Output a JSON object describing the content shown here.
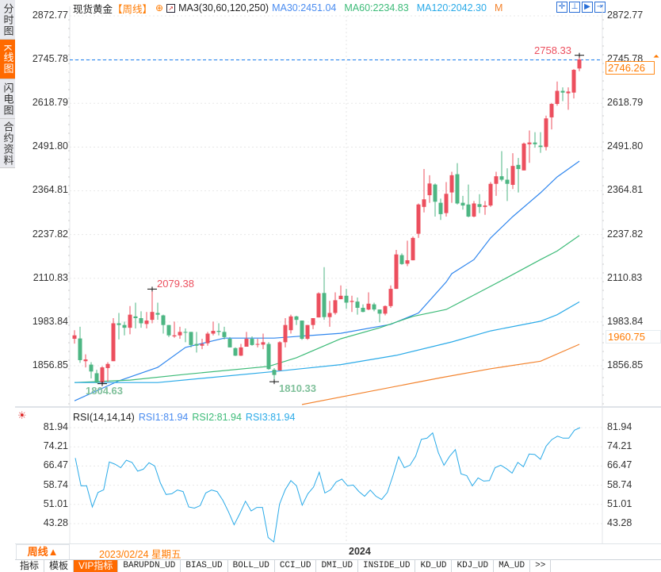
{
  "sidebar": {
    "tabs": [
      {
        "label": "分时图"
      },
      {
        "label": "K线图",
        "active": true
      },
      {
        "label": "闪电图"
      },
      {
        "label": "合约资料"
      }
    ]
  },
  "header": {
    "instrument": "现货黄金",
    "period": "【周线】",
    "ma_label": "MA3(30,60,120,250)",
    "ma30": "MA30:2451.04",
    "ma60": "MA60:2234.83",
    "ma120": "MA120:2042.30",
    "ma_more": "M",
    "toolbar_icons": [
      "crosshair-icon",
      "range-icon",
      "play-icon",
      "exit-icon"
    ]
  },
  "colors": {
    "up": "#ec4f5e",
    "down": "#4db683",
    "ma30": "#2f86ee",
    "ma60": "#3dbb78",
    "ma120": "#2aaae8",
    "ma250": "#f3832d",
    "accent": "#ff6a00",
    "lastline": "#1a7ff0"
  },
  "price_axis": {
    "ticks": [
      "2872.77",
      "2745.78",
      "2618.79",
      "2491.80",
      "2364.81",
      "2237.82",
      "2110.83",
      "1983.84",
      "1856.85"
    ],
    "last_price": "2746.26",
    "ma250_tag": "1960.75"
  },
  "annotations": {
    "high": "2758.33",
    "mid_high": "2079.38",
    "low1": "1804.63",
    "low2": "1810.33"
  },
  "chart_data": [
    {
      "type": "candlestick",
      "period": "weekly",
      "candles_ohlc": [
        [
          1935,
          1960,
          1921,
          1945
        ],
        [
          1936,
          1970,
          1865,
          1873
        ],
        [
          1870,
          1890,
          1852,
          1875
        ],
        [
          1860,
          1867,
          1820,
          1840
        ],
        [
          1835,
          1845,
          1806,
          1808
        ],
        [
          1808,
          1855,
          1804.63,
          1852
        ],
        [
          1850,
          1867,
          1810,
          1862
        ],
        [
          1870,
          1995,
          1870,
          1980
        ],
        [
          1980,
          2010,
          1933,
          1975
        ],
        [
          1975,
          1985,
          1945,
          1967
        ],
        [
          1967,
          2030,
          1948,
          2005
        ],
        [
          2000,
          2040,
          1965,
          1995
        ],
        [
          1995,
          2015,
          1967,
          1980
        ],
        [
          1978,
          2013,
          1965,
          1988
        ],
        [
          1990,
          2079.38,
          1980,
          2013
        ],
        [
          2010,
          2040,
          1990,
          2005
        ],
        [
          2003,
          2005,
          1950,
          1975
        ],
        [
          1975,
          1975,
          1940,
          1945
        ],
        [
          1942,
          1985,
          1938,
          1945
        ],
        [
          1945,
          1970,
          1935,
          1955
        ],
        [
          1955,
          1965,
          1925,
          1953
        ],
        [
          1955,
          1955,
          1910,
          1917
        ],
        [
          1920,
          1955,
          1895,
          1915
        ],
        [
          1915,
          1935,
          1905,
          1920
        ],
        [
          1922,
          1955,
          1915,
          1950
        ],
        [
          1950,
          1985,
          1945,
          1958
        ],
        [
          1958,
          1980,
          1945,
          1955
        ],
        [
          1955,
          1970,
          1933,
          1940
        ],
        [
          1935,
          1940,
          1910,
          1910
        ],
        [
          1908,
          1910,
          1885,
          1886
        ],
        [
          1886,
          1920,
          1885,
          1910
        ],
        [
          1912,
          1955,
          1912,
          1935
        ],
        [
          1935,
          1942,
          1915,
          1917
        ],
        [
          1918,
          1935,
          1910,
          1920
        ],
        [
          1918,
          1950,
          1905,
          1925
        ],
        [
          1920,
          1925,
          1845,
          1847
        ],
        [
          1845,
          1850,
          1810.33,
          1830
        ],
        [
          1843,
          1928,
          1843,
          1925
        ],
        [
          1925,
          1995,
          1910,
          1975
        ],
        [
          1960,
          2005,
          1950,
          2000
        ],
        [
          2000,
          2002,
          1975,
          1990
        ],
        [
          1988,
          1988,
          1932,
          1935
        ],
        [
          1935,
          1975,
          1932,
          1975
        ],
        [
          1975,
          1995,
          1963,
          1995
        ],
        [
          1997,
          2070,
          1997,
          2067
        ],
        [
          2068,
          2143,
          1990,
          1998
        ],
        [
          1998,
          2045,
          1970,
          2010
        ],
        [
          2010,
          2070,
          2005,
          2047
        ],
        [
          2050,
          2090,
          2050,
          2060
        ],
        [
          2060,
          2080,
          2022,
          2040
        ],
        [
          2042,
          2060,
          2013,
          2045
        ],
        [
          2043,
          2055,
          2005,
          2025
        ],
        [
          2025,
          2035,
          2012,
          2013
        ],
        [
          2020,
          2070,
          2018,
          2037
        ],
        [
          2035,
          2040,
          2015,
          2020
        ],
        [
          2020,
          2020,
          1983,
          2008
        ],
        [
          2008,
          2032,
          2003,
          2030
        ],
        [
          2030,
          2090,
          2025,
          2080
        ],
        [
          2080,
          2193,
          2080,
          2180
        ],
        [
          2178,
          2183,
          2150,
          2152
        ],
        [
          2153,
          2220,
          2146,
          2163
        ],
        [
          2163,
          2232,
          2163,
          2228
        ],
        [
          2240,
          2328,
          2228,
          2325
        ],
        [
          2318,
          2428,
          2302,
          2340
        ],
        [
          2352,
          2410,
          2330,
          2386
        ],
        [
          2383,
          2386,
          2290,
          2333
        ],
        [
          2330,
          2342,
          2280,
          2297
        ],
        [
          2300,
          2390,
          2290,
          2356
        ],
        [
          2360,
          2420,
          2330,
          2410
        ],
        [
          2413,
          2445,
          2325,
          2328
        ],
        [
          2330,
          2350,
          2310,
          2322
        ],
        [
          2325,
          2383,
          2288,
          2290
        ],
        [
          2290,
          2335,
          2288,
          2328
        ],
        [
          2326,
          2355,
          2300,
          2318
        ],
        [
          2318,
          2335,
          2295,
          2322
        ],
        [
          2322,
          2390,
          2318,
          2385
        ],
        [
          2385,
          2420,
          2350,
          2407
        ],
        [
          2407,
          2480,
          2392,
          2397
        ],
        [
          2397,
          2430,
          2335,
          2385
        ],
        [
          2382,
          2474,
          2370,
          2437
        ],
        [
          2440,
          2460,
          2360,
          2428
        ],
        [
          2424,
          2505,
          2424,
          2502
        ],
        [
          2500,
          2540,
          2446,
          2505
        ],
        [
          2505,
          2535,
          2490,
          2500
        ],
        [
          2496,
          2535,
          2475,
          2492
        ],
        [
          2492,
          2583,
          2482,
          2575
        ],
        [
          2578,
          2620,
          2543,
          2617
        ],
        [
          2617,
          2682,
          2612,
          2655
        ],
        [
          2655,
          2665,
          2625,
          2650
        ],
        [
          2648,
          2665,
          2600,
          2653
        ],
        [
          2650,
          2718,
          2633,
          2716
        ],
        [
          2720,
          2758.33,
          2712,
          2746.26
        ]
      ],
      "ma_series": {
        "MA30": [
          [
            0,
            1755
          ],
          [
            8,
            1813
          ],
          [
            15,
            1852
          ],
          [
            20,
            1910
          ],
          [
            27,
            1937
          ],
          [
            36,
            1937
          ],
          [
            48,
            1951
          ],
          [
            57,
            1977
          ],
          [
            62,
            2010
          ],
          [
            67,
            2100
          ],
          [
            68,
            2124
          ],
          [
            72,
            2165
          ],
          [
            75,
            2228
          ],
          [
            79,
            2290
          ],
          [
            84,
            2359
          ],
          [
            87,
            2405
          ],
          [
            91,
            2451.04
          ]
        ],
        "MA60": [
          [
            0,
            1808
          ],
          [
            10,
            1815
          ],
          [
            20,
            1832
          ],
          [
            35,
            1855
          ],
          [
            40,
            1880
          ],
          [
            48,
            1935
          ],
          [
            55,
            1967
          ],
          [
            61,
            2000
          ],
          [
            67,
            2020
          ],
          [
            72,
            2062
          ],
          [
            78,
            2113
          ],
          [
            84,
            2165
          ],
          [
            87,
            2190
          ],
          [
            91,
            2234.83
          ]
        ],
        "MA120": [
          [
            0,
            1808
          ],
          [
            15,
            1808
          ],
          [
            36,
            1840
          ],
          [
            48,
            1860
          ],
          [
            58,
            1887
          ],
          [
            68,
            1926
          ],
          [
            75,
            1958
          ],
          [
            84,
            1986
          ],
          [
            87,
            2005
          ],
          [
            91,
            2042.3
          ]
        ],
        "MA250": [
          [
            41,
            1744
          ],
          [
            66,
            1822
          ],
          [
            75,
            1848
          ],
          [
            84,
            1870
          ],
          [
            91,
            1919
          ]
        ]
      },
      "x_label": "2024",
      "ylim": [
        1700,
        2900
      ]
    },
    {
      "type": "line",
      "title": "RSI(14,14,14)",
      "legend": [
        "RSI1:81.94",
        "RSI2:81.94",
        "RSI3:81.94"
      ],
      "ticks": [
        "81.94",
        "74.21",
        "66.47",
        "58.74",
        "51.01",
        "43.28"
      ],
      "values": [
        69.7,
        58.5,
        58.5,
        50.0,
        55.8,
        56.9,
        68.1,
        67.2,
        65.8,
        68.8,
        67.9,
        64.4,
        65.2,
        67.8,
        66.5,
        59.6,
        55.0,
        55.3,
        56.8,
        56.2,
        50.0,
        49.5,
        50.5,
        55.6,
        56.8,
        56.2,
        52.7,
        48.1,
        42.8,
        47.3,
        52.3,
        48.4,
        49.8,
        49.8,
        37.7,
        35.9,
        51.1,
        56.9,
        60.6,
        58.5,
        50.7,
        55.3,
        58.0,
        64.0,
        55.6,
        56.9,
        60.1,
        61.2,
        58.5,
        58.8,
        56.2,
        54.3,
        56.8,
        54.3,
        53.0,
        55.8,
        62.6,
        70.2,
        65.8,
        66.8,
        70.4,
        77.2,
        77.7,
        79.8,
        71.8,
        66.8,
        70.4,
        73.1,
        63.3,
        62.6,
        58.5,
        61.7,
        60.4,
        60.6,
        65.8,
        66.8,
        65.4,
        63.6,
        67.9,
        66.2,
        71.3,
        71.1,
        69.2,
        74.5,
        77.1,
        78.5,
        77.7,
        77.7,
        80.9,
        81.94
      ]
    }
  ],
  "timebar": {
    "period": "周线▲",
    "cursor_date": "2023/02/24 星期五",
    "year": "2024"
  },
  "bottom_tabs": [
    {
      "label": "指标"
    },
    {
      "label": "模板"
    },
    {
      "label": "VIP指标",
      "active": true
    },
    {
      "label": "BARUPDN_UD"
    },
    {
      "label": "BIAS_UD"
    },
    {
      "label": "BOLL_UD"
    },
    {
      "label": "CCI_UD"
    },
    {
      "label": "DMI_UD"
    },
    {
      "label": "INSIDE_UD"
    },
    {
      "label": "KD_UD"
    },
    {
      "label": "KDJ_UD"
    },
    {
      "label": "MA_UD"
    },
    {
      "label": ">>"
    }
  ]
}
